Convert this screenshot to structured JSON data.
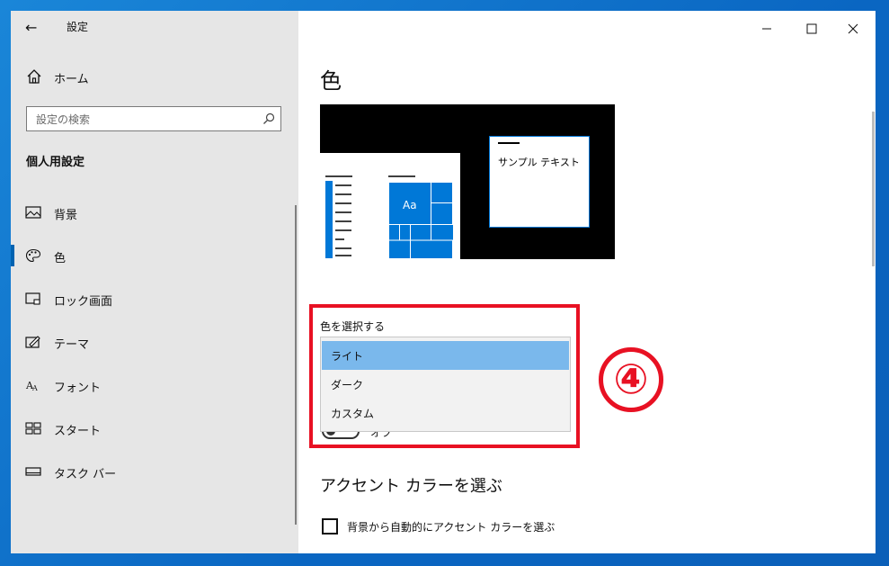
{
  "window": {
    "title": "設定"
  },
  "sidebar": {
    "home_label": "ホーム",
    "search_placeholder": "設定の検索",
    "section_title": "個人用設定",
    "items": [
      {
        "label": "背景",
        "icon": "picture-icon",
        "active": false
      },
      {
        "label": "色",
        "icon": "palette-icon",
        "active": true
      },
      {
        "label": "ロック画面",
        "icon": "lock-screen-icon",
        "active": false
      },
      {
        "label": "テーマ",
        "icon": "theme-icon",
        "active": false
      },
      {
        "label": "フォント",
        "icon": "font-icon",
        "active": false
      },
      {
        "label": "スタート",
        "icon": "start-icon",
        "active": false
      },
      {
        "label": "タスク バー",
        "icon": "taskbar-icon",
        "active": false
      }
    ]
  },
  "main": {
    "page_title": "色",
    "preview": {
      "tile_text": "Aa",
      "sample_text": "サンプル テキスト"
    },
    "choose_color_label": "色を選択する",
    "dropdown_options": [
      {
        "label": "ライト",
        "selected": true
      },
      {
        "label": "ダーク",
        "selected": false
      },
      {
        "label": "カスタム",
        "selected": false
      }
    ],
    "toggle_label": "オフ",
    "step_marker": "④",
    "accent_title": "アクセント カラーを選ぶ",
    "auto_accent_label": "背景から自動的にアクセント カラーを選ぶ"
  },
  "colors": {
    "accent": "#0078d7",
    "selected_option": "#7ab8ec",
    "highlight_red": "#e81123",
    "sidebar_bg": "#e6e6e6"
  }
}
